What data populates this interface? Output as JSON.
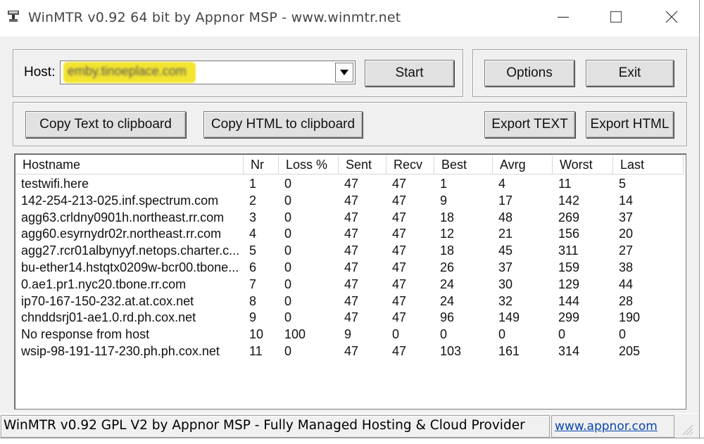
{
  "window": {
    "title": "WinMTR v0.92 64 bit by Appnor MSP - www.winmtr.net"
  },
  "host": {
    "label": "Host:",
    "value": "emby.tinoeplace.com"
  },
  "buttons": {
    "start": "Start",
    "options": "Options",
    "exit": "Exit",
    "copy_text": "Copy Text to clipboard",
    "copy_html": "Copy HTML to clipboard",
    "export_text": "Export TEXT",
    "export_html": "Export HTML"
  },
  "table": {
    "columns": [
      "Hostname",
      "Nr",
      "Loss %",
      "Sent",
      "Recv",
      "Best",
      "Avrg",
      "Worst",
      "Last"
    ],
    "rows": [
      [
        "testwifi.here",
        "1",
        "0",
        "47",
        "47",
        "1",
        "4",
        "11",
        "5"
      ],
      [
        "142-254-213-025.inf.spectrum.com",
        "2",
        "0",
        "47",
        "47",
        "9",
        "17",
        "142",
        "14"
      ],
      [
        "agg63.crldny0901h.northeast.rr.com",
        "3",
        "0",
        "47",
        "47",
        "18",
        "48",
        "269",
        "37"
      ],
      [
        "agg60.esyrnydr02r.northeast.rr.com",
        "4",
        "0",
        "47",
        "47",
        "12",
        "21",
        "156",
        "20"
      ],
      [
        "agg27.rcr01albynyyf.netops.charter.c...",
        "5",
        "0",
        "47",
        "47",
        "18",
        "45",
        "311",
        "27"
      ],
      [
        "bu-ether14.hstqtx0209w-bcr00.tbone...",
        "6",
        "0",
        "47",
        "47",
        "26",
        "37",
        "159",
        "38"
      ],
      [
        "0.ae1.pr1.nyc20.tbone.rr.com",
        "7",
        "0",
        "47",
        "47",
        "24",
        "30",
        "129",
        "44"
      ],
      [
        "ip70-167-150-232.at.at.cox.net",
        "8",
        "0",
        "47",
        "47",
        "24",
        "32",
        "144",
        "28"
      ],
      [
        "chnddsrj01-ae1.0.rd.ph.cox.net",
        "9",
        "0",
        "47",
        "47",
        "96",
        "149",
        "299",
        "190"
      ],
      [
        "No response from host",
        "10",
        "100",
        "9",
        "0",
        "0",
        "0",
        "0",
        "0"
      ],
      [
        "wsip-98-191-117-230.ph.ph.cox.net",
        "11",
        "0",
        "47",
        "47",
        "103",
        "161",
        "314",
        "205"
      ]
    ]
  },
  "statusbar": {
    "text": "WinMTR v0.92 GPL V2 by Appnor MSP - Fully Managed Hosting & Cloud Provider",
    "link": "www.appnor.com"
  },
  "icons": {
    "app": "winmtr-app-icon",
    "minimize": "minimize-icon",
    "maximize": "maximize-icon",
    "close": "close-icon",
    "dropdown": "chevron-down-icon"
  }
}
